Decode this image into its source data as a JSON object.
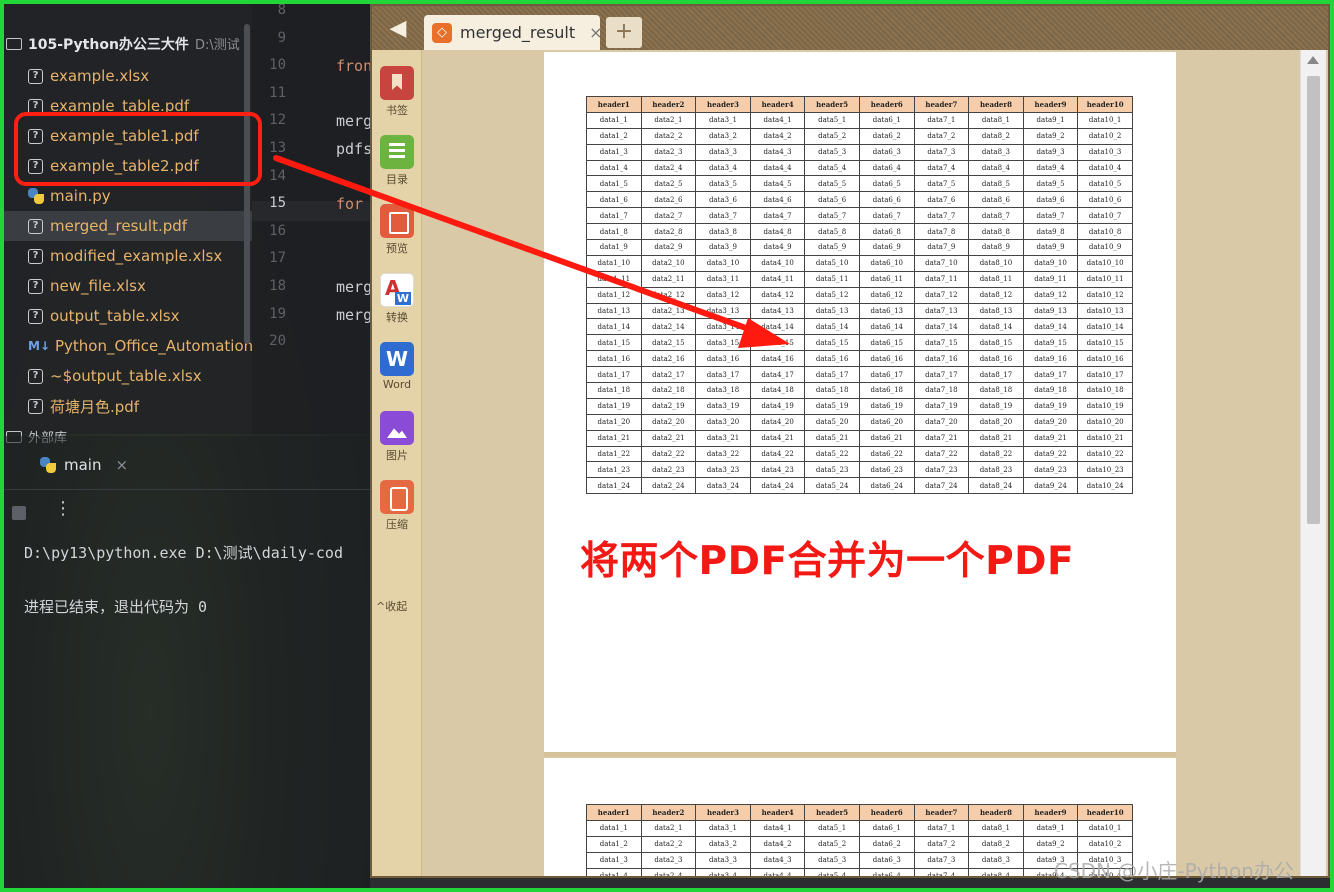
{
  "ide": {
    "project": {
      "root_name": "105-Python办公三大件",
      "root_path": "D:\\测试",
      "files": [
        {
          "name": "example.xlsx",
          "icon": "unknown-file-icon"
        },
        {
          "name": "example_table.pdf",
          "icon": "unknown-file-icon"
        },
        {
          "name": "example_table1.pdf",
          "icon": "unknown-file-icon"
        },
        {
          "name": "example_table2.pdf",
          "icon": "unknown-file-icon"
        },
        {
          "name": "main.py",
          "icon": "python-file-icon"
        },
        {
          "name": "merged_result.pdf",
          "icon": "unknown-file-icon"
        },
        {
          "name": "modified_example.xlsx",
          "icon": "unknown-file-icon"
        },
        {
          "name": "new_file.xlsx",
          "icon": "unknown-file-icon"
        },
        {
          "name": "output_table.xlsx",
          "icon": "unknown-file-icon"
        },
        {
          "name": "Python_Office_Automation_",
          "icon": "markdown-file-icon"
        },
        {
          "name": "~$output_table.xlsx",
          "icon": "unknown-file-icon"
        },
        {
          "name": "荷塘月色.pdf",
          "icon": "unknown-file-icon"
        }
      ],
      "external_libraries": "外部库"
    },
    "editor": {
      "line_numbers": [
        "8",
        "9",
        "10",
        "11",
        "12",
        "13",
        "14",
        "15",
        "16",
        "17",
        "18",
        "19",
        "20"
      ],
      "current_line": "15",
      "code_fragments": [
        {
          "line": "10",
          "text": "fron",
          "kind": "kw"
        },
        {
          "line": "12",
          "text": "merg",
          "kind": "plain"
        },
        {
          "line": "13",
          "text": "pdfs",
          "kind": "plain"
        },
        {
          "line": "15",
          "text": "for",
          "kind": "kw"
        },
        {
          "line": "18",
          "text": "merg",
          "kind": "plain"
        },
        {
          "line": "19",
          "text": "merg",
          "kind": "plain"
        }
      ]
    },
    "run": {
      "tab_label": "main",
      "tab_close": "×",
      "console_lines": [
        "D:\\py13\\python.exe D:\\测试\\daily-cod",
        "进程已结束，退出代码为 0"
      ]
    }
  },
  "viewer": {
    "back_icon": "◀▌",
    "tab_title": "merged_result",
    "tab_close": "×",
    "add_tab": "+",
    "sidebar": [
      {
        "label": "书签",
        "icon": "bookmark-icon"
      },
      {
        "label": "目录",
        "icon": "toc-icon"
      },
      {
        "label": "预览",
        "icon": "preview-icon"
      },
      {
        "label": "转换",
        "icon": "pdf-to-word-icon"
      },
      {
        "label": "Word",
        "icon": "word-icon"
      },
      {
        "label": "图片",
        "icon": "image-icon"
      },
      {
        "label": "压缩",
        "icon": "compress-icon"
      }
    ],
    "collapse_label": "^收起",
    "table": {
      "headers": [
        "header1",
        "header2",
        "header3",
        "header4",
        "header5",
        "header6",
        "header7",
        "header8",
        "header9",
        "header10"
      ],
      "rows": 24,
      "cell_prefix": "data",
      "page2_rows": 4
    },
    "annotation": "将两个PDF合并为一个PDF"
  },
  "watermark": "CSDN @小庄-Python办公",
  "colors": {
    "frame": "#22d63a",
    "annotation": "#f31a15",
    "file_text": "#e7b36a",
    "header_fill": "#f6cdaa"
  }
}
